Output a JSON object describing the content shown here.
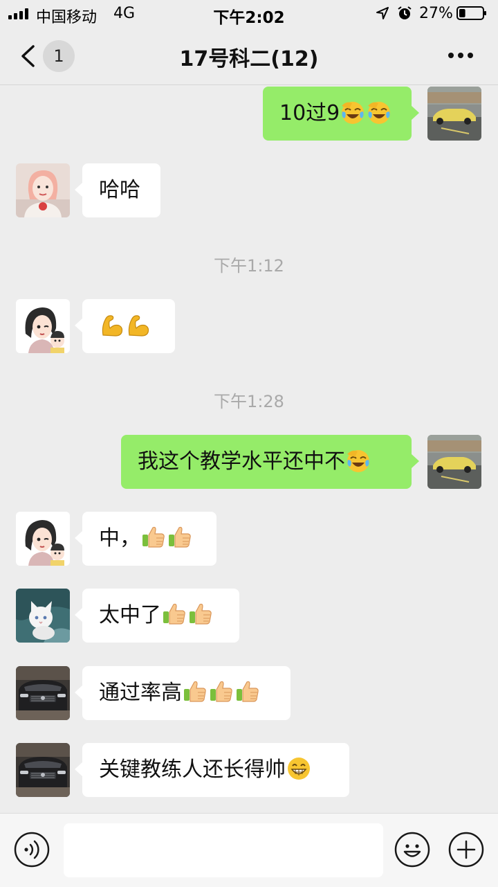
{
  "status_bar": {
    "carrier": "中国移动",
    "network": "4G",
    "time": "下午2:02",
    "battery_percent": "27%",
    "battery_level": 0.27
  },
  "nav": {
    "back_badge": "1",
    "title": "17号科二(12)"
  },
  "timestamps": [
    "下午1:12",
    "下午1:28"
  ],
  "messages": [
    {
      "side": "right",
      "text": "10过9",
      "emojis": [
        "laugh-cry",
        "laugh-cry"
      ],
      "avatar": "car-photo"
    },
    {
      "side": "left",
      "text": "哈哈",
      "emojis": [],
      "avatar": "girl-photo"
    },
    {
      "side": "left",
      "text": "",
      "emojis": [
        "flexed-biceps",
        "flexed-biceps"
      ],
      "avatar": "cartoon-woman-child"
    },
    {
      "side": "right",
      "text": "我这个教学水平还中不",
      "emojis": [
        "laugh-cry"
      ],
      "avatar": "car-photo"
    },
    {
      "side": "left",
      "text": "中，",
      "emojis": [
        "thumbs-up",
        "thumbs-up"
      ],
      "avatar": "cartoon-woman-child"
    },
    {
      "side": "left",
      "text": "太中了",
      "emojis": [
        "thumbs-up",
        "thumbs-up"
      ],
      "avatar": "white-cat"
    },
    {
      "side": "left",
      "text": "通过率高",
      "emojis": [
        "thumbs-up",
        "thumbs-up",
        "thumbs-up"
      ],
      "avatar": "suv-front"
    },
    {
      "side": "left",
      "text": "关键教练人还长得帅",
      "emojis": [
        "grin"
      ],
      "avatar": "suv-front"
    }
  ],
  "colors": {
    "background": "#ededed",
    "bubble_sent": "#95ec69",
    "bubble_received": "#ffffff",
    "timestamp_text": "#a9a9a9"
  },
  "icons": {
    "back": "chevron-left-icon",
    "more": "more-dots-icon",
    "voice": "voice-icon",
    "emoji": "smiley-icon",
    "plus": "plus-icon"
  }
}
